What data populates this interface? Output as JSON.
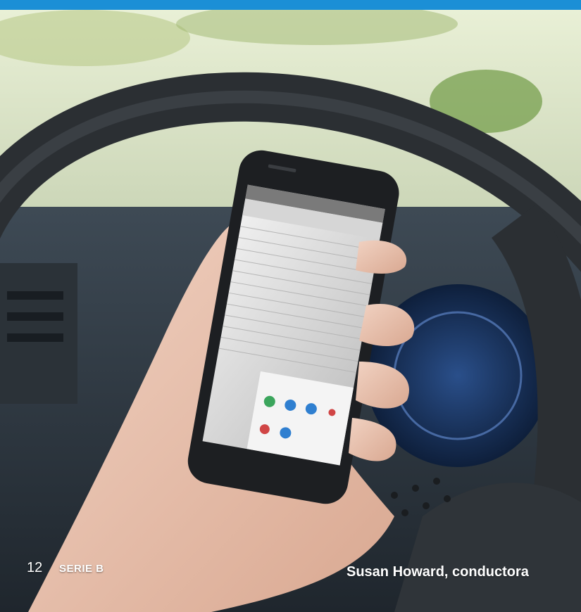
{
  "page": {
    "number": "12",
    "section": "SERIE B"
  },
  "caption": {
    "credit": "Susan Howard, conductora"
  },
  "colors": {
    "top_bar": "#1b8fd6",
    "caption_text": "#ffffff"
  },
  "photo": {
    "description_icons": [
      "steering-wheel-icon",
      "smartphone-icon",
      "hand-icon"
    ]
  }
}
